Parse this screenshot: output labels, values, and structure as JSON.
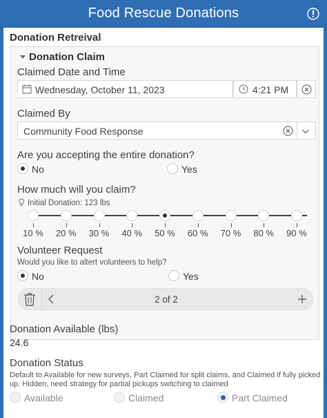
{
  "header": {
    "title": "Food Rescue Donations",
    "icon": "alert-icon"
  },
  "section": {
    "title": "Donation Retreival"
  },
  "claim": {
    "title": "Donation Claim",
    "date_label": "Claimed Date and Time",
    "date_value": "Wednesday, October 11, 2023",
    "time_value": "4:21 PM",
    "claimed_by_label": "Claimed By",
    "claimed_by_value": "Community Food Response",
    "entire_label": "Are you accepting the entire donation?",
    "entire_options": [
      "No",
      "Yes"
    ],
    "entire_selected": "No",
    "amount_label": "How much will you claim?",
    "amount_hint": "Initial Donation: 123 lbs",
    "amount_stops": [
      "10 %",
      "20 %",
      "30 %",
      "40 %",
      "50 %",
      "60 %",
      "70 %",
      "80 %",
      "90 %"
    ],
    "amount_selected_index": 4,
    "volunteer_label": "Volunteer Request",
    "volunteer_hint": "Would you like to altert volunteers to help?",
    "volunteer_options": [
      "No",
      "Yes"
    ],
    "volunteer_selected": "No",
    "pager_text": "2 of 2"
  },
  "available": {
    "label": "Donation Available (lbs)",
    "value": "24.6"
  },
  "status": {
    "label": "Donation Status",
    "hint_line1": "Default to Available for new surveys, Part Claimed for split claims, and Claimed if fully picked",
    "hint_line2": "up. Hidden, need strategy for partial pickups switching to claimed",
    "options": [
      "Available",
      "Claimed",
      "Part Claimed"
    ],
    "selected": "Part Claimed"
  },
  "colors": {
    "header": "#2f6db5",
    "selected_radio": "#3e53b8"
  }
}
